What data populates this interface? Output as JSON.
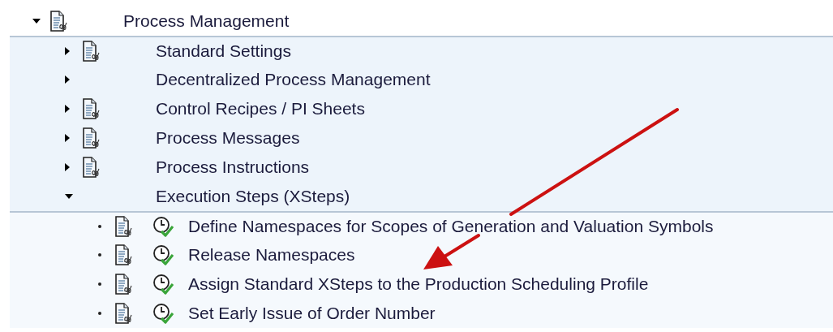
{
  "tree": [
    {
      "label": "Process Management",
      "kind": "document",
      "expanded": true,
      "children": [
        {
          "label": "Standard Settings",
          "kind": "document",
          "expanded": false
        },
        {
          "label": "Decentralized Process Management",
          "kind": "plain",
          "expanded": false
        },
        {
          "label": "Control Recipes / PI Sheets",
          "kind": "document",
          "expanded": false
        },
        {
          "label": "Process Messages",
          "kind": "document",
          "expanded": false
        },
        {
          "label": "Process Instructions",
          "kind": "document",
          "expanded": false
        },
        {
          "label": "Execution Steps (XSteps)",
          "kind": "plain",
          "expanded": true,
          "children": [
            {
              "label": "Define Namespaces for Scopes of Generation and Valuation Symbols",
              "kind": "activity"
            },
            {
              "label": "Release Namespaces",
              "kind": "activity"
            },
            {
              "label": "Assign Standard XSteps to the Production Scheduling Profile",
              "kind": "activity"
            },
            {
              "label": "Set Early Issue of Order Number",
              "kind": "activity"
            }
          ]
        }
      ]
    }
  ]
}
